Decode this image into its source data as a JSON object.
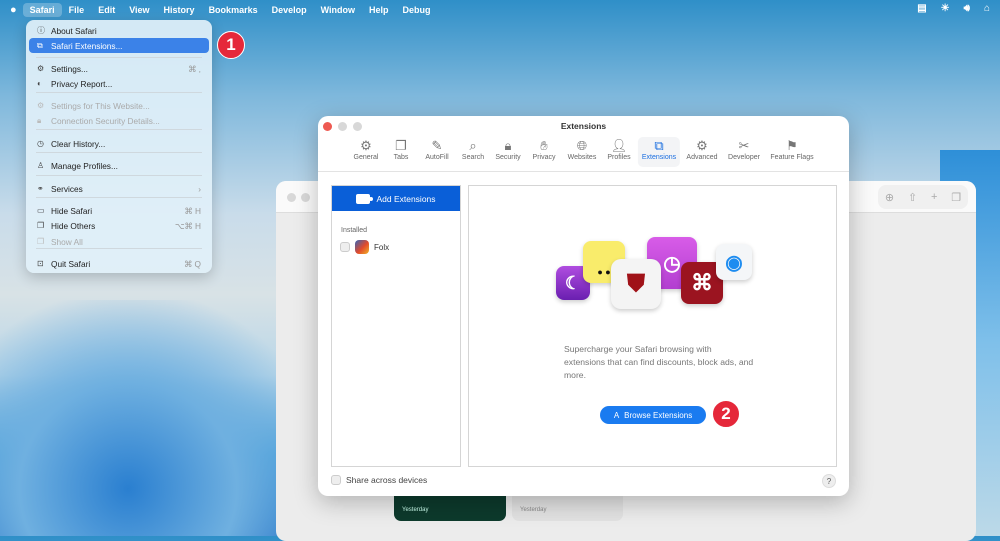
{
  "menubar": {
    "apple": "",
    "items": [
      "Safari",
      "File",
      "Edit",
      "View",
      "History",
      "Bookmarks",
      "Develop",
      "Window",
      "Help",
      "Debug"
    ]
  },
  "safari_menu": [
    {
      "label": "About Safari",
      "icon": "info-icon",
      "shortcut": "",
      "state": "normal"
    },
    {
      "label": "Safari Extensions...",
      "icon": "extensions-icon",
      "shortcut": "",
      "state": "highlighted"
    },
    {
      "label": "Settings...",
      "icon": "gear-icon",
      "shortcut": "⌘ ,",
      "state": "normal"
    },
    {
      "label": "Privacy Report...",
      "icon": "privacy-icon",
      "shortcut": "",
      "state": "normal"
    },
    {
      "label": "Settings for This Website...",
      "icon": "gear-icon",
      "shortcut": "",
      "state": "disabled"
    },
    {
      "label": "Connection Security Details...",
      "icon": "lock-icon",
      "shortcut": "",
      "state": "disabled"
    },
    {
      "label": "Clear History...",
      "icon": "clock-icon",
      "shortcut": "",
      "state": "normal"
    },
    {
      "label": "Manage Profiles...",
      "icon": "person-icon",
      "shortcut": "",
      "state": "normal"
    },
    {
      "label": "Services",
      "icon": "services-icon",
      "shortcut": "›",
      "state": "normal"
    },
    {
      "label": "Hide Safari",
      "icon": "window-icon",
      "shortcut": "⌘ H",
      "state": "normal"
    },
    {
      "label": "Hide Others",
      "icon": "windows-icon",
      "shortcut": "⌥⌘ H",
      "state": "normal"
    },
    {
      "label": "Show All",
      "icon": "windows-icon",
      "shortcut": "",
      "state": "disabled"
    },
    {
      "label": "Quit Safari",
      "icon": "quit-icon",
      "shortcut": "⌘ Q",
      "state": "normal"
    }
  ],
  "badges": [
    "1",
    "2"
  ],
  "window": {
    "title": "Extensions",
    "tabs": [
      {
        "label": "General",
        "icon": "⚙"
      },
      {
        "label": "Tabs",
        "icon": "❐"
      },
      {
        "label": "AutoFill",
        "icon": "✎"
      },
      {
        "label": "Search",
        "icon": "⌕"
      },
      {
        "label": "Security",
        "icon": "🔒︎"
      },
      {
        "label": "Privacy",
        "icon": "✋︎"
      },
      {
        "label": "Websites",
        "icon": "🌐︎"
      },
      {
        "label": "Profiles",
        "icon": "👤︎"
      },
      {
        "label": "Extensions",
        "icon": "⧉"
      },
      {
        "label": "Advanced",
        "icon": "⚙"
      },
      {
        "label": "Developer",
        "icon": "✂"
      },
      {
        "label": "Feature Flags",
        "icon": "⚑"
      }
    ],
    "selected_tab": "Extensions",
    "add_extensions": "Add Extensions",
    "installed_label": "Installed",
    "extensions": [
      {
        "name": "Folx",
        "enabled": false
      }
    ],
    "description": "Supercharge your Safari browsing with extensions that can find discounts, block ads, and more.",
    "browse_button": "Browse Extensions",
    "share_label": "Share across devices",
    "help": "?"
  },
  "background_browser": {
    "thumbnails": [
      "Yesterday",
      "Yesterday"
    ]
  },
  "colors": {
    "accent": "#0a5fd8",
    "badge": "#e5283a"
  }
}
